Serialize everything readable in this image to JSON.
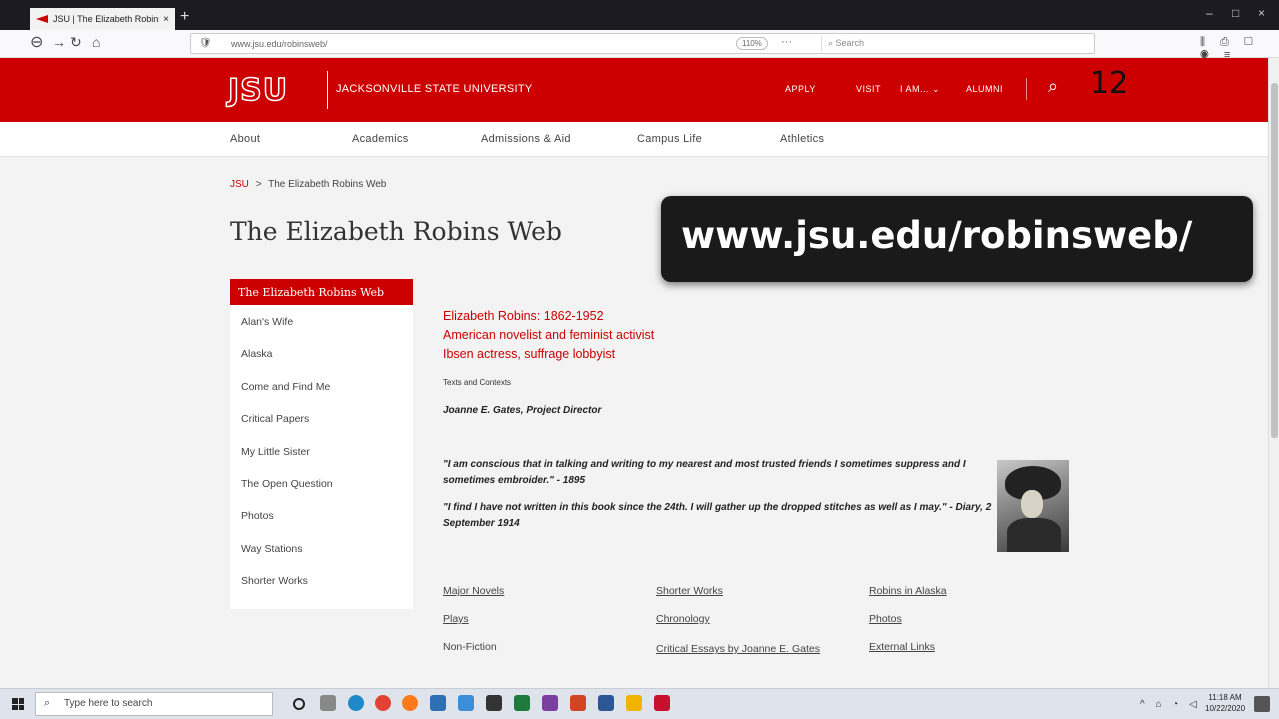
{
  "browser": {
    "tab_title": "JSU | The Elizabeth Robins Web",
    "tab_close": "×",
    "new_tab": "+",
    "url": "www.jsu.edu/robinsweb/",
    "zoom": "110%",
    "more": "···",
    "search_placeholder": "Search",
    "win_minimize": "–",
    "win_maximize": "□",
    "win_close": "×"
  },
  "header": {
    "logo": "JSU",
    "university": "JACKSONVILLE STATE UNIVERSITY",
    "nav": [
      "APPLY",
      "VISIT",
      "I AM... ⌄",
      "ALUMNI"
    ],
    "slide_number": "12",
    "accent": "#cc0000"
  },
  "subnav": [
    "About",
    "Academics",
    "Admissions & Aid",
    "Campus Life",
    "Athletics"
  ],
  "breadcrumb": {
    "home": "JSU",
    "separator": ">",
    "current": "The Elizabeth Robins Web"
  },
  "page_title": "The Elizabeth Robins Web",
  "sidebar": {
    "heading": "The Elizabeth Robins Web",
    "items": [
      "Alan's Wife",
      "Alaska",
      "Come and Find Me",
      "Critical Papers",
      "My Little Sister",
      "The Open Question",
      "Photos",
      "Way Stations",
      "Shorter Works"
    ]
  },
  "intro": {
    "line1": "Elizabeth Robins: 1862-1952",
    "line2": "American novelist and feminist activist",
    "line3": "Ibsen actress, suffrage lobbyist"
  },
  "texts_contexts": "Texts and Contexts",
  "director": "Joanne E. Gates, Project Director",
  "quotes": [
    "\"I am conscious that in talking and writing to my nearest and most trusted friends I sometimes suppress and I sometimes embroider.\" - 1895",
    "\"I find I have not written in this book since the 24th. I will gather up the dropped stitches as well as I may.\" - Diary, 2 September 1914"
  ],
  "links": {
    "col1": [
      "Major Novels",
      "Plays",
      "Non-Fiction"
    ],
    "col2": [
      "Shorter Works",
      "Chronology",
      "Critical Essays by Joanne E. Gates"
    ],
    "col3": [
      "Robins in Alaska",
      "Photos",
      "External Links"
    ]
  },
  "overlay_text": "www.jsu.edu/robinsweb/",
  "taskbar": {
    "search_placeholder": "Type here to search",
    "time": "11:18 AM",
    "date": "10/22/2020"
  }
}
